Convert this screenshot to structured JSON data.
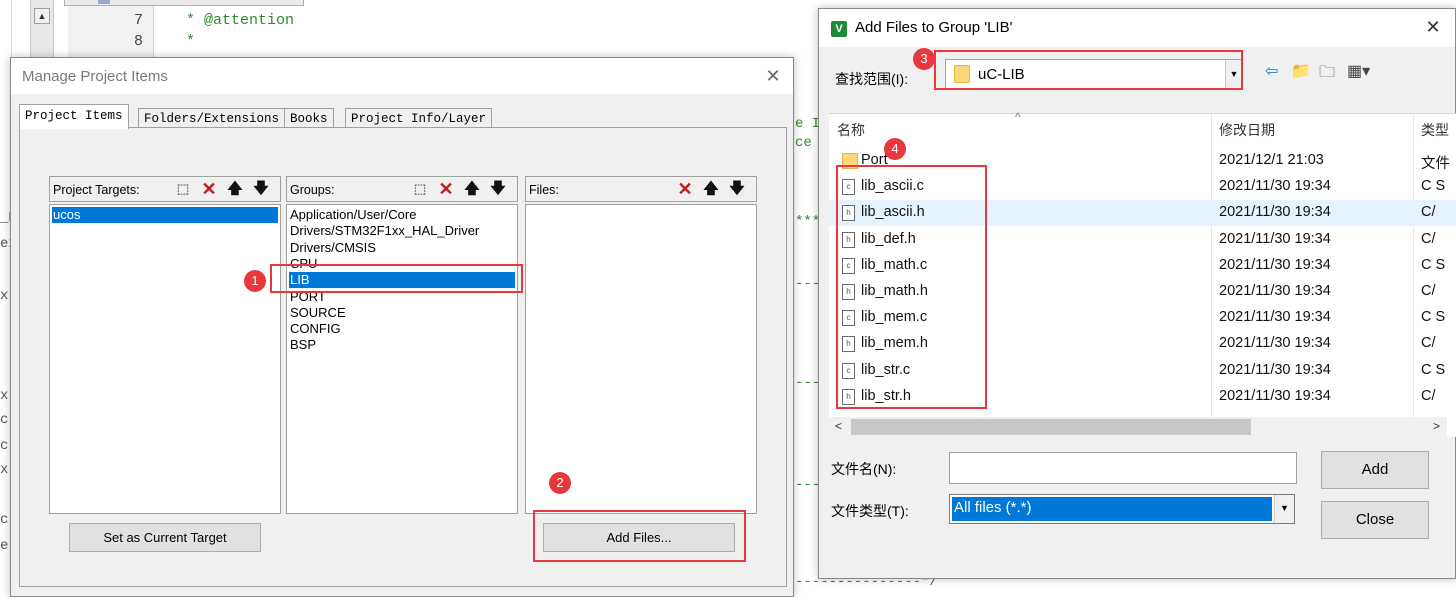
{
  "editor": {
    "lines": [
      {
        "num": "7",
        "code": "* @attention"
      },
      {
        "num": "8",
        "code": "*"
      }
    ],
    "frag_e1": "e I",
    "frag_ce": "ce",
    "frag_stars": "***",
    "frag_dash1": "---",
    "frag_dash2": "---",
    "frag_dash3": "---",
    "frag_bottom": "---------------*/",
    "left_frags": [
      "_D",
      "ex",
      "x.",
      "x.",
      "c",
      "c",
      "x.",
      "c",
      "e"
    ]
  },
  "manage_dialog": {
    "title": "Manage Project Items",
    "tabs": [
      "Project Items",
      "Folders/Extensions",
      "Books",
      "Project Info/Layer"
    ],
    "targets": {
      "label": "Project Targets:",
      "items": [
        "ucos"
      ]
    },
    "groups": {
      "label": "Groups:",
      "items": [
        "Application/User/Core",
        "Drivers/STM32F1xx_HAL_Driver",
        "Drivers/CMSIS",
        "CPU",
        "LIB",
        "PORT",
        "SOURCE",
        "CONFIG",
        "BSP"
      ],
      "selected": "LIB"
    },
    "files": {
      "label": "Files:"
    },
    "set_target_button": "Set as Current Target",
    "add_files_button": "Add Files..."
  },
  "add_dialog": {
    "title": "Add Files to Group 'LIB'",
    "lookin_label": "查找范围(I):",
    "lookin_value": "uC-LIB",
    "columns": [
      "名称",
      "修改日期",
      "类型"
    ],
    "files": [
      {
        "name": "Port",
        "date": "2021/12/1 21:03",
        "type": "文件",
        "icon": "folder-icon"
      },
      {
        "name": "lib_ascii.c",
        "date": "2021/11/30 19:34",
        "type": "C S",
        "icon": "c-file-icon"
      },
      {
        "name": "lib_ascii.h",
        "date": "2021/11/30 19:34",
        "type": "C/",
        "icon": "h-file-icon"
      },
      {
        "name": "lib_def.h",
        "date": "2021/11/30 19:34",
        "type": "C/",
        "icon": "h-file-icon"
      },
      {
        "name": "lib_math.c",
        "date": "2021/11/30 19:34",
        "type": "C S",
        "icon": "c-file-icon"
      },
      {
        "name": "lib_math.h",
        "date": "2021/11/30 19:34",
        "type": "C/",
        "icon": "h-file-icon"
      },
      {
        "name": "lib_mem.c",
        "date": "2021/11/30 19:34",
        "type": "C S",
        "icon": "c-file-icon"
      },
      {
        "name": "lib_mem.h",
        "date": "2021/11/30 19:34",
        "type": "C/",
        "icon": "h-file-icon"
      },
      {
        "name": "lib_str.c",
        "date": "2021/11/30 19:34",
        "type": "C S",
        "icon": "c-file-icon"
      },
      {
        "name": "lib_str.h",
        "date": "2021/11/30 19:34",
        "type": "C/",
        "icon": "h-file-icon"
      }
    ],
    "filename_label": "文件名(N):",
    "filename_value": "",
    "filetype_label": "文件类型(T):",
    "filetype_value": "All files (*.*)",
    "add_button": "Add",
    "close_button": "Close"
  },
  "annotations": [
    "1",
    "2",
    "3",
    "4"
  ],
  "colors": {
    "highlight": "#e8383d",
    "selection": "#0078d7"
  }
}
